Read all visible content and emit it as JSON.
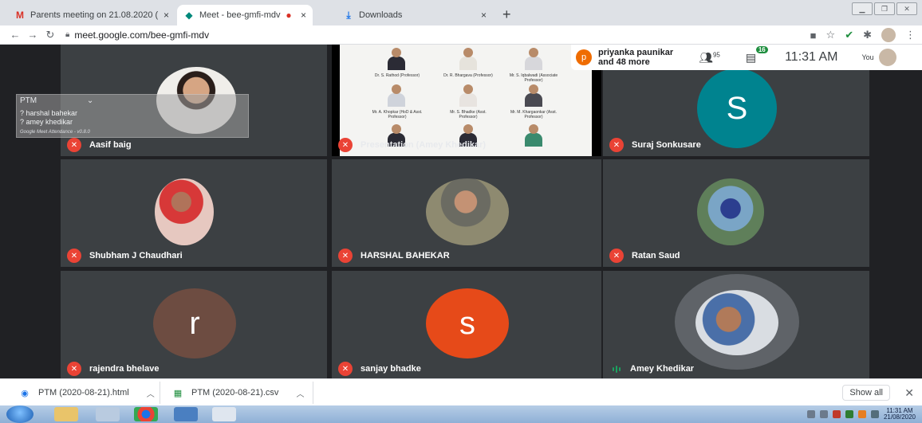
{
  "tabs": [
    {
      "title": "Parents meeting on 21.08.2020 (",
      "icon": "gmail-icon"
    },
    {
      "title": "Meet - bee-gmfi-mdv",
      "icon": "meet-icon",
      "active": true
    },
    {
      "title": "Downloads",
      "icon": "download-icon"
    }
  ],
  "tab_close": "×",
  "new_tab": "+",
  "address": {
    "url": "meet.google.com/bee-gmfi-mdv"
  },
  "meet": {
    "participants_summary": {
      "name": "priyanka paunikar",
      "more": "and 48 more",
      "avatar_letter": "p"
    },
    "people_count": "95",
    "chat_count": "16",
    "time": "11:31 AM",
    "you_label": "You",
    "tiles": [
      {
        "name": "Aasif baig",
        "status": "muted",
        "kind": "photo"
      },
      {
        "name": "Presentation (Amey Khedikar)",
        "status": "presenting",
        "kind": "slide"
      },
      {
        "name": "Suraj Sonkusare",
        "status": "muted",
        "kind": "letter",
        "letter": "S",
        "color": "#00838f"
      },
      {
        "name": "Shubham J Chaudhari",
        "status": "muted",
        "kind": "photo"
      },
      {
        "name": "HARSHAL BAHEKAR",
        "status": "muted",
        "kind": "photo"
      },
      {
        "name": "Ratan Saud",
        "status": "muted",
        "kind": "photo"
      },
      {
        "name": "rajendra bhelave",
        "status": "muted",
        "kind": "letter",
        "letter": "r",
        "color": "#6d4c41"
      },
      {
        "name": "sanjay bhadke",
        "status": "muted",
        "kind": "letter",
        "letter": "s",
        "color": "#e64a19"
      },
      {
        "name": "Amey Khedikar",
        "status": "speaking",
        "kind": "photo"
      }
    ],
    "slide_captions": [
      "Dr. S. Rathod (Professor)",
      "Dr. R. Bhargava (Professor)",
      "Mr. S. Iqbalwadi (Associate Professor)",
      "Mr. A. Khopkar (HoD & Asst. Professor)",
      "Mr. S. Bhadke (Asst. Professor)",
      "Mr. M. Khargaonkar (Asst. Professor)"
    ]
  },
  "attendance_widget": {
    "title": "PTM",
    "names": [
      "? harshal bahekar",
      "? amey khedikar"
    ],
    "footer": "Google Meet Attendance - v0.8.0"
  },
  "downloads": [
    {
      "name": "PTM (2020-08-21).html",
      "icon": "chrome-file-icon"
    },
    {
      "name": "PTM (2020-08-21).csv",
      "icon": "csv-file-icon"
    }
  ],
  "show_all": "Show all",
  "taskbar": {
    "time": "11:31 AM",
    "date": "21/08/2020"
  },
  "colors": {
    "muted": "#ea4335",
    "speaking": "#1aa260",
    "tile_bg": "#3c4043"
  }
}
